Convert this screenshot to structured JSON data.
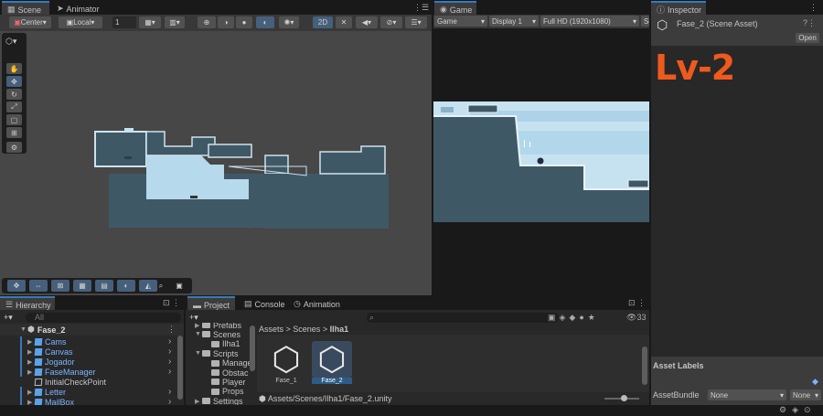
{
  "scene_tabs": {
    "scene": "Scene",
    "animator": "Animator",
    "game": "Game",
    "inspector": "Inspector"
  },
  "scene_toolbar": {
    "pivot": "Center",
    "space": "Local",
    "snap_value": "1",
    "mode_2d": "2D"
  },
  "game_toolbar": {
    "view": "Game",
    "display": "Display 1",
    "resolution": "Full HD (1920x1080)",
    "scale": "Sc"
  },
  "inspector": {
    "title": "Fase_2 (Scene Asset)",
    "open": "Open",
    "overlay_text": "Lv-2",
    "asset_labels": "Asset Labels",
    "asset_bundle_label": "AssetBundle",
    "asset_bundle_value": "None",
    "asset_variant_value": "None"
  },
  "hierarchy": {
    "tab": "Hierarchy",
    "search_placeholder": "All",
    "scene": "Fase_2",
    "items": [
      {
        "label": "Cams",
        "prefab": true,
        "expandable": true
      },
      {
        "label": "Canvas",
        "prefab": true,
        "expandable": true
      },
      {
        "label": "Jogador",
        "prefab": true,
        "expandable": true
      },
      {
        "label": "FaseManager",
        "prefab": true,
        "expandable": true
      },
      {
        "label": "InitialCheckPoint",
        "prefab": false,
        "expandable": false
      },
      {
        "label": "Letter",
        "prefab": true,
        "expandable": true
      },
      {
        "label": "MailBox",
        "prefab": true,
        "expandable": true
      }
    ]
  },
  "project": {
    "tabs": [
      "Project",
      "Console",
      "Animation"
    ],
    "count": "33",
    "tree": [
      {
        "label": "Prefabs",
        "indent": 1,
        "cut": true
      },
      {
        "label": "Scenes",
        "indent": 1,
        "open": true
      },
      {
        "label": "Ilha1",
        "indent": 2
      },
      {
        "label": "Scripts",
        "indent": 1,
        "open": true
      },
      {
        "label": "Manager",
        "indent": 2
      },
      {
        "label": "Obstac",
        "indent": 2
      },
      {
        "label": "Player",
        "indent": 2
      },
      {
        "label": "Props",
        "indent": 2
      },
      {
        "label": "Settings",
        "indent": 1
      }
    ],
    "breadcrumb": [
      "Assets",
      "Scenes",
      "Ilha1"
    ],
    "assets": [
      "Fase_1",
      "Fase_2"
    ],
    "path": "Assets/Scenes/Ilha1/Fase_2.unity"
  },
  "colors": {
    "accent": "#3a79bb",
    "selection": "#2c5d87",
    "overlay_text": "#ef5a1c",
    "sky": "#c6e2f0",
    "ground": "#3f5866"
  }
}
